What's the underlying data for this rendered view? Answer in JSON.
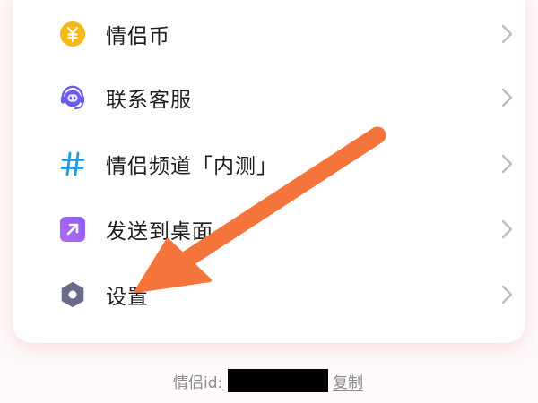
{
  "menu": {
    "items": [
      {
        "label": "情侣币",
        "icon": "yen-coin-icon"
      },
      {
        "label": "联系客服",
        "icon": "customer-service-robot-icon"
      },
      {
        "label": "情侣频道「内测」",
        "icon": "hashtag-icon"
      },
      {
        "label": "发送到桌面",
        "icon": "send-to-desktop-arrow-icon"
      },
      {
        "label": "设置",
        "icon": "gear-icon"
      }
    ]
  },
  "footer": {
    "id_label": "情侣id:",
    "copy_label": "复制"
  },
  "colors": {
    "annotation_arrow": "#f4743b",
    "coin": "#f6b91a",
    "service_icon": "#6b5cf0",
    "hashtag": "#1a9be6",
    "send_icon": "#9b6cf2",
    "gear": "#6a6a8a",
    "chevron": "#bdbdbd"
  }
}
